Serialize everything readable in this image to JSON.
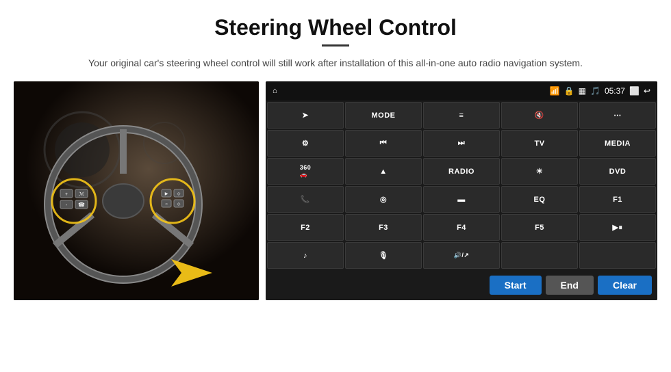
{
  "header": {
    "title": "Steering Wheel Control",
    "subtitle": "Your original car's steering wheel control will still work after installation of this all-in-one auto radio navigation system."
  },
  "status_bar": {
    "time": "05:37",
    "home_icon": "⌂",
    "wifi_icon": "WiFi",
    "lock_icon": "🔒",
    "sim_icon": "SIM",
    "bt_icon": "BT",
    "screen_icon": "⬜",
    "back_icon": "↩"
  },
  "grid_buttons": [
    {
      "label": "➤",
      "icon": true
    },
    {
      "label": "MODE"
    },
    {
      "label": "≡",
      "icon": true
    },
    {
      "label": "🔇",
      "icon": true
    },
    {
      "label": "⋯",
      "icon": true
    },
    {
      "label": "⚙",
      "icon": true
    },
    {
      "label": "⏮",
      "icon": true
    },
    {
      "label": "⏭",
      "icon": true
    },
    {
      "label": "TV"
    },
    {
      "label": "MEDIA"
    },
    {
      "label": "360🚗",
      "icon": true
    },
    {
      "label": "▲",
      "icon": true
    },
    {
      "label": "RADIO"
    },
    {
      "label": "☀",
      "icon": true
    },
    {
      "label": "DVD"
    },
    {
      "label": "📞",
      "icon": true
    },
    {
      "label": "◎",
      "icon": true
    },
    {
      "label": "▬",
      "icon": true
    },
    {
      "label": "EQ"
    },
    {
      "label": "F1"
    },
    {
      "label": "F2"
    },
    {
      "label": "F3"
    },
    {
      "label": "F4"
    },
    {
      "label": "F5"
    },
    {
      "label": "▶⏸",
      "icon": true
    },
    {
      "label": "♪",
      "icon": true
    },
    {
      "label": "🎙",
      "icon": true
    },
    {
      "label": "🔊/↗",
      "icon": true
    },
    {
      "label": ""
    },
    {
      "label": ""
    }
  ],
  "bottom_buttons": {
    "start": "Start",
    "end": "End",
    "clear": "Clear"
  }
}
